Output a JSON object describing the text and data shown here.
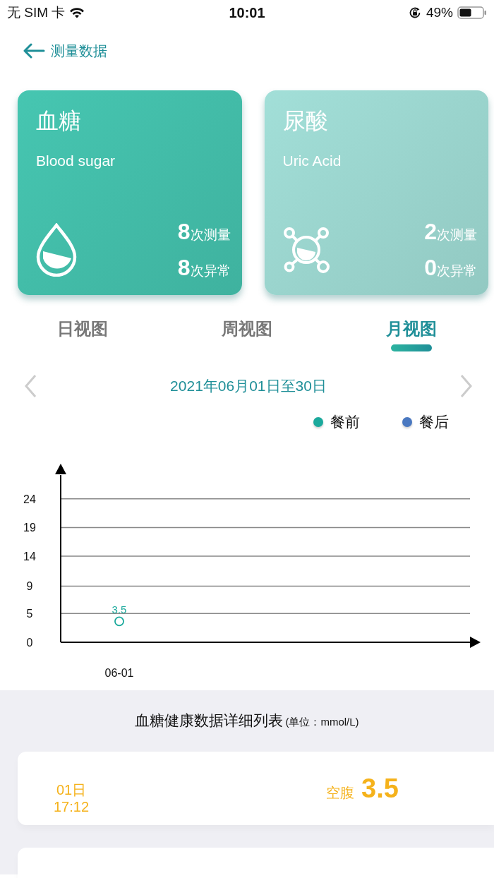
{
  "status_bar": {
    "carrier": "无 SIM 卡",
    "time": "10:01",
    "battery": "49%"
  },
  "header": {
    "title": "测量数据"
  },
  "cards": [
    {
      "kind": "drop",
      "title": "血糖",
      "subtitle": "Blood sugar",
      "color": "#46c6b1",
      "stats": [
        {
          "count": "8",
          "label": "次测量"
        },
        {
          "count": "8",
          "label": "次异常"
        }
      ]
    },
    {
      "kind": "molecule",
      "title": "尿酸",
      "subtitle": "Uric Acid",
      "color": "#a2dfd8",
      "stats": [
        {
          "count": "2",
          "label": "次测量"
        },
        {
          "count": "0",
          "label": "次异常"
        }
      ]
    }
  ],
  "tabs": [
    {
      "label": "日视图",
      "selected": false
    },
    {
      "label": "周视图",
      "selected": false
    },
    {
      "label": "月视图",
      "selected": true
    }
  ],
  "date_range": {
    "label": "2021年06月01日至30日"
  },
  "chart": {
    "chart_data": {
      "type": "scatter",
      "categories": [
        "06-01"
      ],
      "series": [
        {
          "name": "餐前",
          "color": "#1ba99c",
          "values": [
            3.5
          ]
        },
        {
          "name": "餐后",
          "color": "#4a78c0",
          "values": [
            null
          ]
        }
      ],
      "ylim": [
        0,
        28
      ],
      "yticks": [
        0,
        {
          "value": 4.8,
          "label": "5"
        },
        {
          "value": 9.4,
          "label": "9"
        },
        {
          "value": 14.4,
          "label": "14"
        },
        {
          "value": 19.2,
          "label": "19"
        },
        24
      ],
      "grid": true,
      "data_labels": true
    }
  },
  "list": {
    "title": "血糖健康数据详细列表",
    "unit": "(单位：mmol/L)",
    "records": [
      {
        "kind": "full",
        "day": "01日",
        "time": "17:12",
        "type": "空腹",
        "value": "3.5"
      },
      {
        "kind": "cut"
      }
    ]
  }
}
